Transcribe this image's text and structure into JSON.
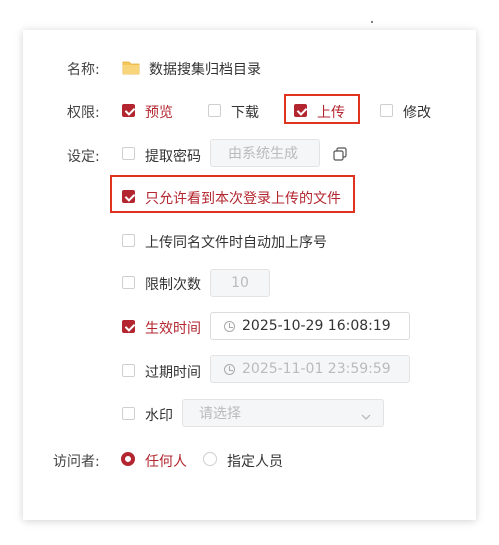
{
  "name_label": "名称:",
  "name_value": "数据搜集归档目录",
  "perm_label": "权限:",
  "permissions": [
    {
      "label": "预览",
      "checked": true
    },
    {
      "label": "下载",
      "checked": false
    },
    {
      "label": "上传",
      "checked": true
    },
    {
      "label": "修改",
      "checked": false
    }
  ],
  "settings_label": "设定:",
  "extract_code": {
    "label": "提取密码",
    "checked": false,
    "placeholder": "由系统生成"
  },
  "only_own": {
    "label": "只允许看到本次登录上传的文件",
    "checked": true
  },
  "auto_seq": {
    "label": "上传同名文件时自动加上序号",
    "checked": false
  },
  "limit_count": {
    "label": "限制次数",
    "checked": false,
    "value": "10"
  },
  "effective_time": {
    "label": "生效时间",
    "checked": true,
    "value": "2025-10-29 16:08:19"
  },
  "expire_time": {
    "label": "过期时间",
    "checked": false,
    "value": "2025-11-01 23:59:59"
  },
  "watermark": {
    "label": "水印",
    "checked": false,
    "placeholder": "请选择"
  },
  "visitor_label": "访问者:",
  "visitors": [
    {
      "label": "任何人",
      "selected": true
    },
    {
      "label": "指定人员",
      "selected": false
    }
  ],
  "colors": {
    "accent": "#b3262f",
    "highlight": "#e0331f",
    "folder": "#f5c75a"
  }
}
